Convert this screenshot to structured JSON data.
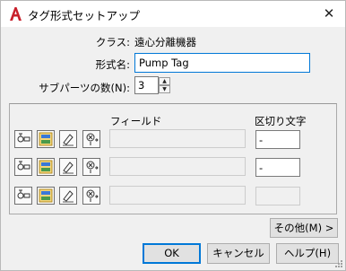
{
  "window": {
    "title": "タグ形式セットアップ",
    "close_symbol": "✕"
  },
  "class_row": {
    "label": "クラス:",
    "value": "遠心分離機器"
  },
  "format_name": {
    "label": "形式名:",
    "value": "Pump Tag"
  },
  "subparts": {
    "label": "サブパーツの数(N):",
    "value": "3",
    "up_symbol": "▲",
    "down_symbol": "▼"
  },
  "fields": {
    "header_field": "フィールド",
    "header_delimiter": "区切り文字",
    "rows": [
      {
        "field_value": "",
        "delimiter": "-"
      },
      {
        "field_value": "",
        "delimiter": "-"
      },
      {
        "field_value": "",
        "delimiter": ""
      }
    ]
  },
  "buttons": {
    "more": "その他(M) >",
    "ok": "OK",
    "cancel": "キャンセル",
    "help": "ヘルプ(H)"
  },
  "colors": {
    "accent": "#0078d7",
    "app_icon": "#c8202b"
  }
}
